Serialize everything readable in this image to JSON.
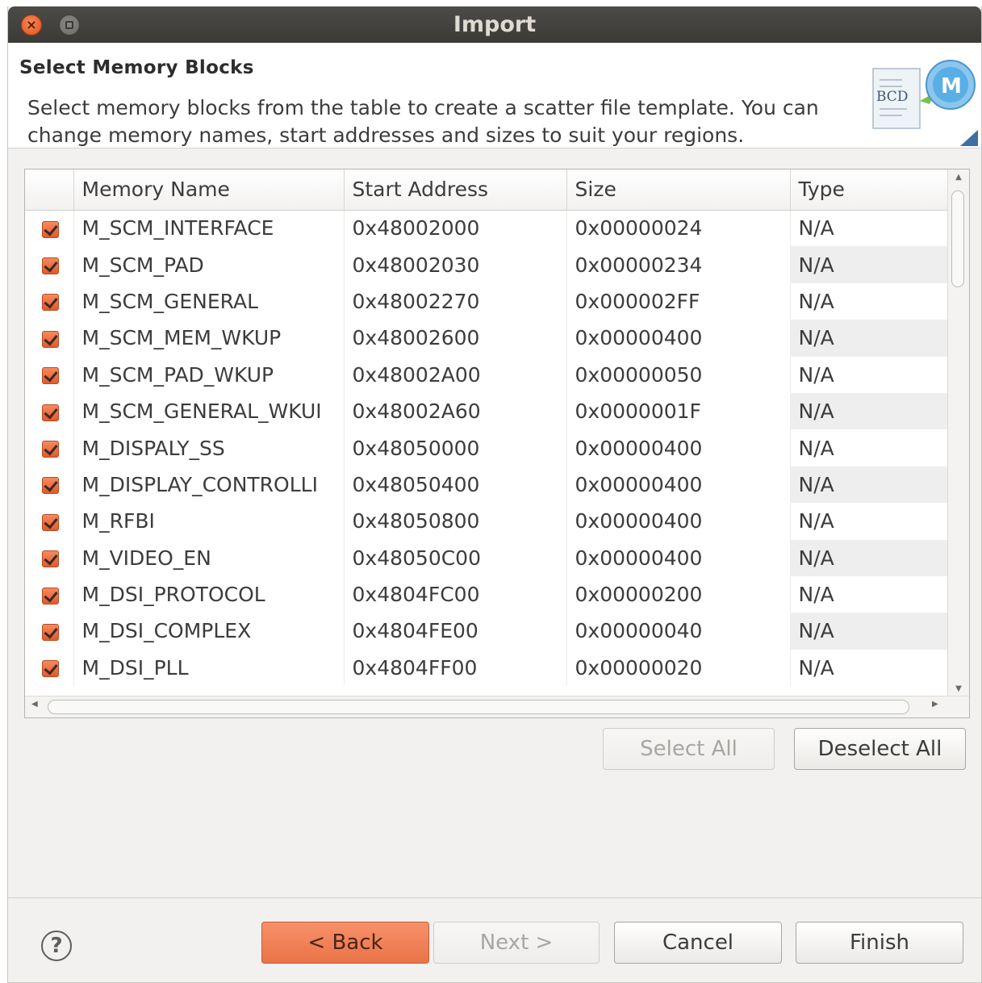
{
  "window": {
    "title": "Import"
  },
  "header": {
    "title": "Select Memory Blocks",
    "description": "Select memory blocks from the table to create a scatter file template. You can change memory names, start addresses and sizes to suit your regions.",
    "icon_text_left": "BCD",
    "icon_text_right": "M"
  },
  "table": {
    "columns": [
      "",
      "Memory Name",
      "Start Address",
      "Size",
      "Type"
    ],
    "rows": [
      {
        "checked": true,
        "name": "M_SCM_INTERFACE",
        "start": "0x48002000",
        "size": "0x00000024",
        "type": "N/A"
      },
      {
        "checked": true,
        "name": "M_SCM_PAD",
        "start": "0x48002030",
        "size": "0x00000234",
        "type": "N/A"
      },
      {
        "checked": true,
        "name": "M_SCM_GENERAL",
        "start": "0x48002270",
        "size": "0x000002FF",
        "type": "N/A"
      },
      {
        "checked": true,
        "name": "M_SCM_MEM_WKUP",
        "start": "0x48002600",
        "size": "0x00000400",
        "type": "N/A"
      },
      {
        "checked": true,
        "name": "M_SCM_PAD_WKUP",
        "start": "0x48002A00",
        "size": "0x00000050",
        "type": "N/A"
      },
      {
        "checked": true,
        "name": "M_SCM_GENERAL_WKUI",
        "start": "0x48002A60",
        "size": "0x0000001F",
        "type": "N/A"
      },
      {
        "checked": true,
        "name": "M_DISPALY_SS",
        "start": "0x48050000",
        "size": "0x00000400",
        "type": "N/A"
      },
      {
        "checked": true,
        "name": "M_DISPLAY_CONTROLLI",
        "start": "0x48050400",
        "size": "0x00000400",
        "type": "N/A"
      },
      {
        "checked": true,
        "name": "M_RFBI",
        "start": "0x48050800",
        "size": "0x00000400",
        "type": "N/A"
      },
      {
        "checked": true,
        "name": "M_VIDEO_EN",
        "start": "0x48050C00",
        "size": "0x00000400",
        "type": "N/A"
      },
      {
        "checked": true,
        "name": "M_DSI_PROTOCOL",
        "start": "0x4804FC00",
        "size": "0x00000200",
        "type": "N/A"
      },
      {
        "checked": true,
        "name": "M_DSI_COMPLEX",
        "start": "0x4804FE00",
        "size": "0x00000040",
        "type": "N/A"
      },
      {
        "checked": true,
        "name": "M_DSI_PLL",
        "start": "0x4804FF00",
        "size": "0x00000020",
        "type": "N/A"
      }
    ]
  },
  "buttons": {
    "select_all": "Select All",
    "deselect_all": "Deselect All",
    "help": "?",
    "back": "< Back",
    "next": "Next >",
    "cancel": "Cancel",
    "finish": "Finish"
  },
  "colors": {
    "accent": "#ea7347",
    "checkbox": "#e4592a",
    "titlebar": "#3b3a36"
  }
}
